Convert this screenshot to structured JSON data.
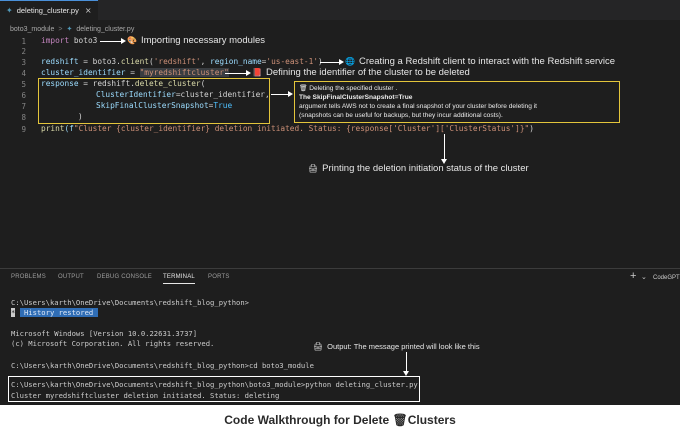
{
  "tab": {
    "filename": "deleting_cluster.py",
    "close_icon": "×"
  },
  "breadcrumb": {
    "folder": "boto3_module",
    "separator": ">",
    "file": "deleting_cluster.py"
  },
  "line_numbers": [
    "1",
    "2",
    "3",
    "4",
    "5",
    "6",
    "7",
    "8",
    "9"
  ],
  "code": {
    "l1_kw": "import",
    "l1_rest": " boto3",
    "l3_a": "redshift",
    "l3_b": " = boto3.",
    "l3_c": "client",
    "l3_d": "(",
    "l3_e": "'redshift'",
    "l3_f": ", ",
    "l3_g": "region_name",
    "l3_h": "=",
    "l3_i": "'us-east-1'",
    "l3_j": ")",
    "l4_a": "cluster_identifier",
    "l4_b": " = ",
    "l4_c": "\"myredshiftcluster\"",
    "l5_a": "response",
    "l5_b": " = redshift.",
    "l5_c": "delete_cluster",
    "l5_d": "(",
    "l6_a": "ClusterIdentifier",
    "l6_b": "=cluster_identifier,",
    "l7_a": "SkipFinalClusterSnapshot",
    "l7_b": "=",
    "l7_c": "True",
    "l8_a": ")",
    "l9_a": "print",
    "l9_b": "(f",
    "l9_c": "\"Cluster {cluster_identifier} deletion initiated. Status: {response['Cluster']['ClusterStatus']}\"",
    "l9_d": ")"
  },
  "annotations": {
    "import": "Importing necessary modules",
    "client": "Creating a Redshift client to interact with the Redshift service",
    "identifier": "Defining the identifier of the cluster to be deleted",
    "print": "Printing the deletion initiation status of the cluster",
    "output": "Output: The message printed will look like this"
  },
  "note": {
    "title": "Deleting the specified cluster .",
    "bold": "The SkipFinalClusterSnapshot=True",
    "body1": "argument tells AWS not to create a final snapshot of your cluster before deleting it",
    "body2": "(snapshots can be useful for backups, but they incur additional costs)."
  },
  "panel": {
    "tabs": [
      "PROBLEMS",
      "OUTPUT",
      "DEBUG CONSOLE",
      "TERMINAL",
      "PORTS"
    ],
    "active_tab": "TERMINAL",
    "plus": "+",
    "chevron": "⌄",
    "right_label": "CodeGPT"
  },
  "terminal": {
    "prompt1": "C:\\Users\\karth\\OneDrive\\Documents\\redshift_blog_python>",
    "restored_star": "*",
    "restored": " History restored ",
    "win1": "Microsoft Windows [Version 10.0.22631.3737]",
    "win2": "(c) Microsoft Corporation. All rights reserved.",
    "cd": "C:\\Users\\karth\\OneDrive\\Documents\\redshift_blog_python>cd boto3_module",
    "run": "C:\\Users\\karth\\OneDrive\\Documents\\redshift_blog_python\\boto3_module>python deleting_cluster.py",
    "out": "Cluster myredshiftcluster deletion initiated. Status: deleting"
  },
  "caption": {
    "before": "Code Walkthrough for Delete ",
    "after": "Clusters"
  },
  "icons": {
    "import_icon": "🎨",
    "client_icon": "🌐",
    "identifier_icon": "📕",
    "print_icon": "🖨",
    "output_icon": "🖨",
    "note_icon": "🗑",
    "caption_icon": "🗑"
  },
  "colors": {
    "editor_bg": "#1e1e1e",
    "highlight_box": "#e3c53b",
    "keyword": "#c586c0",
    "string": "#ce9178",
    "function": "#dcdcaa"
  }
}
